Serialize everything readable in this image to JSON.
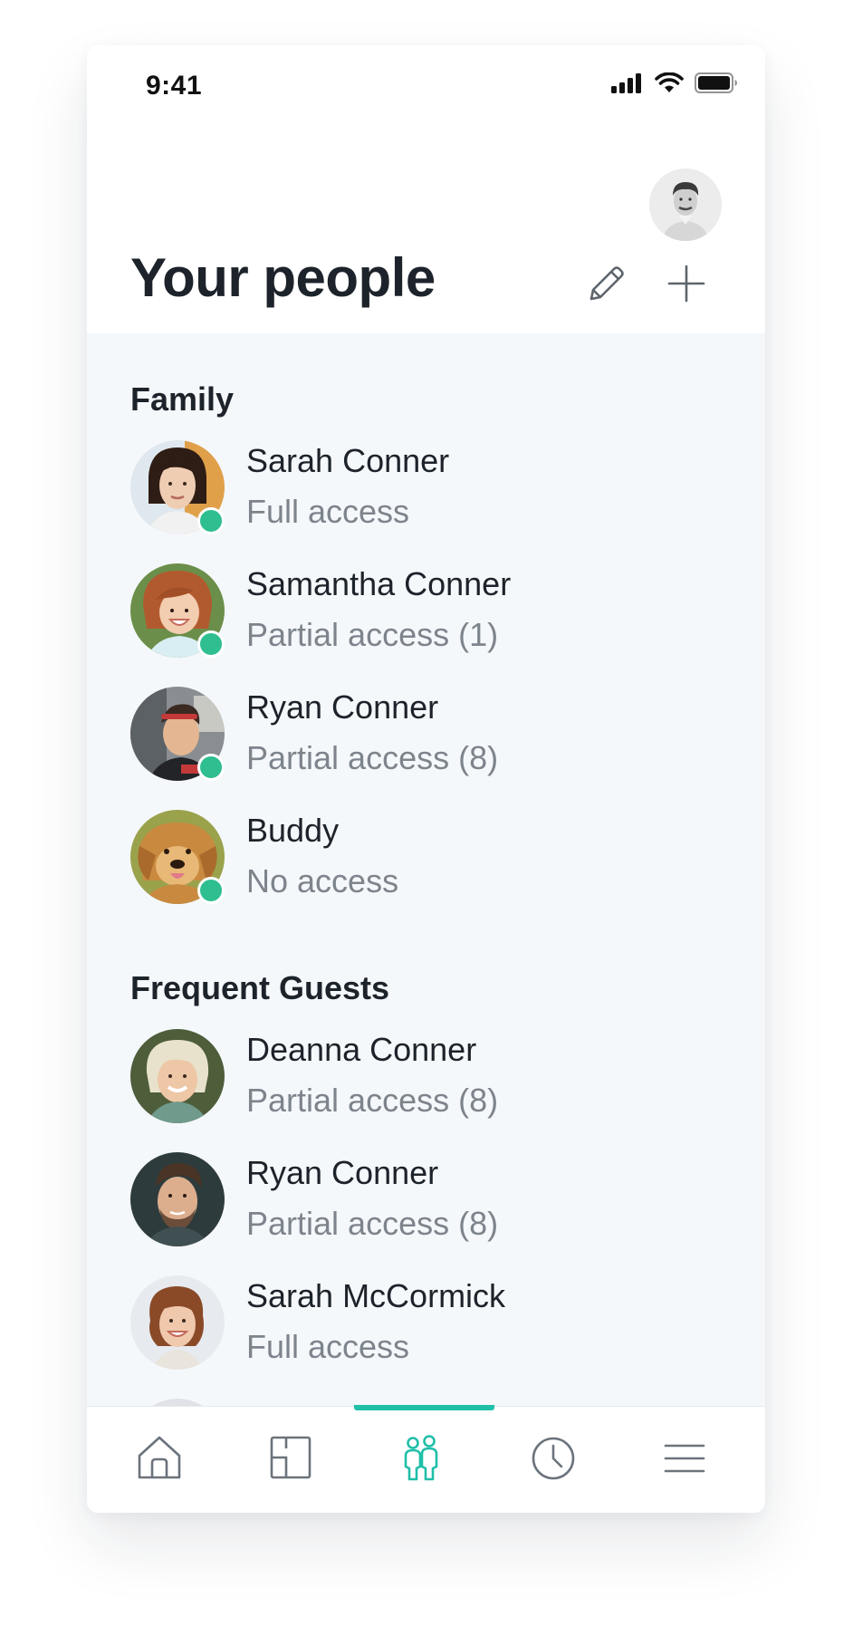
{
  "status_bar": {
    "time": "9:41",
    "icons": [
      "cellular-signal-icon",
      "wifi-icon",
      "battery-icon"
    ]
  },
  "header": {
    "title": "Your people",
    "actions": [
      "pencil-icon",
      "plus-icon"
    ]
  },
  "sections": [
    {
      "title": "Family",
      "people": [
        {
          "name": "Sarah Conner",
          "access": "Full access",
          "online": true
        },
        {
          "name": "Samantha Conner",
          "access": "Partial access (1)",
          "online": true
        },
        {
          "name": "Ryan Conner",
          "access": "Partial access (8)",
          "online": true
        },
        {
          "name": "Buddy",
          "access": "No access",
          "online": true
        }
      ]
    },
    {
      "title": "Frequent Guests",
      "people": [
        {
          "name": "Deanna Conner",
          "access": "Partial access (8)",
          "online": false
        },
        {
          "name": "Ryan Conner",
          "access": "Partial access (8)",
          "online": false
        },
        {
          "name": "Sarah McCormick",
          "access": "Full access",
          "online": false
        }
      ]
    }
  ],
  "tab_bar": {
    "tabs": [
      {
        "icon": "home-icon",
        "active": false
      },
      {
        "icon": "floorplan-icon",
        "active": false
      },
      {
        "icon": "people-icon",
        "active": true
      },
      {
        "icon": "clock-icon",
        "active": false
      },
      {
        "icon": "menu-icon",
        "active": false
      }
    ]
  },
  "colors": {
    "accent": "#1fbfa8",
    "online": "#2fbe8f",
    "text_primary": "#1d232a",
    "text_secondary": "#7d848c",
    "icon_inactive": "#6b737c",
    "content_background": "#f5f8fb"
  }
}
